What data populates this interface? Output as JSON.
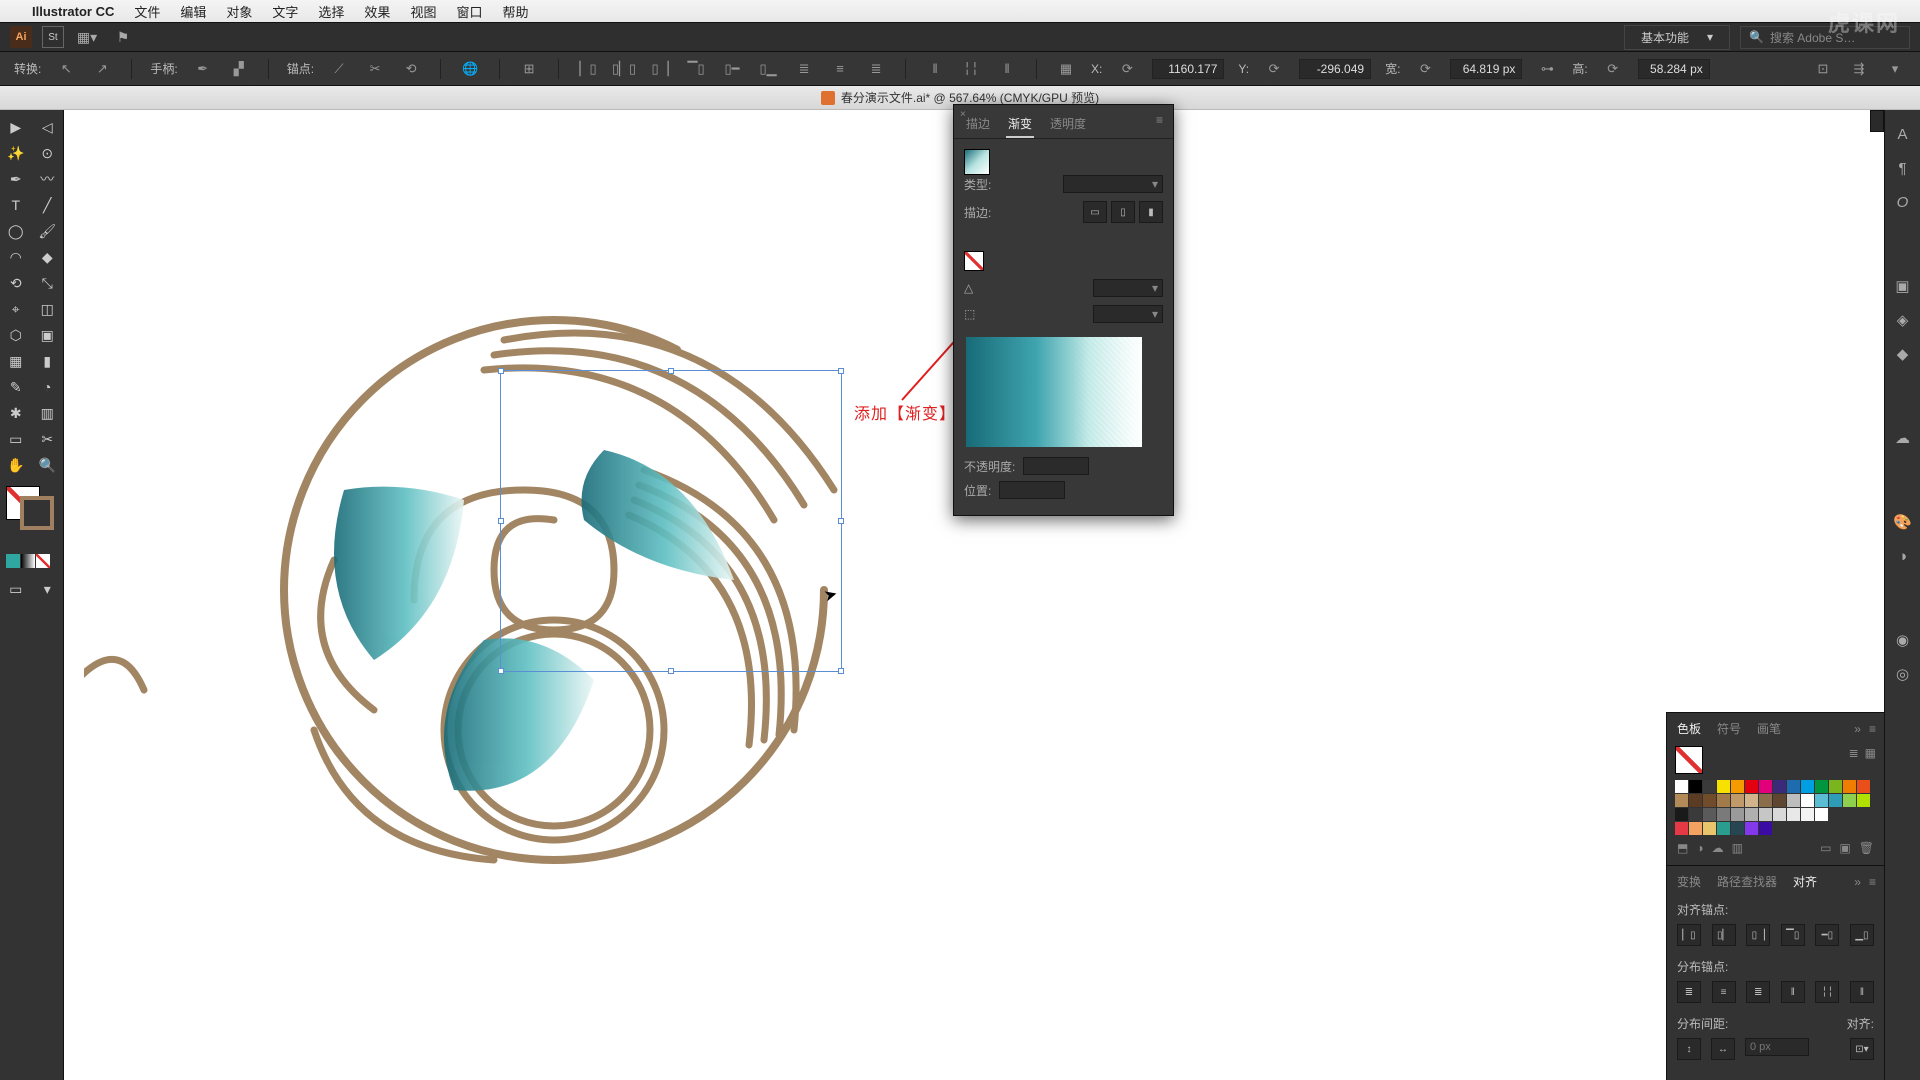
{
  "watermark": "虎课网",
  "mac_menu": {
    "app_name": "Illustrator CC",
    "items": [
      "文件",
      "编辑",
      "对象",
      "文字",
      "选择",
      "效果",
      "视图",
      "窗口",
      "帮助"
    ]
  },
  "app_bar": {
    "ai_label": "Ai",
    "st_label": "St",
    "basic_func": "基本功能",
    "search_placeholder": "搜索 Adobe S…"
  },
  "control_bar": {
    "transform_label": "转换:",
    "handle_label": "手柄:",
    "anchor_label": "锚点:",
    "x_label": "X:",
    "x_value": "1160.177",
    "y_label": "Y:",
    "y_value": "-296.049",
    "w_label": "宽:",
    "w_value": "64.819 px",
    "h_label": "高:",
    "h_value": "58.284 px"
  },
  "document": {
    "title": "春分演示文件.ai* @ 567.64% (CMYK/GPU 预览)"
  },
  "annotation": {
    "text": "添加【渐变】效果"
  },
  "gradient_panel": {
    "tab_stroke": "描边",
    "tab_gradient": "渐变",
    "tab_opacity": "透明度",
    "type_label": "类型:",
    "stroke_label": "描边:",
    "opacity_label": "不透明度:",
    "position_label": "位置:"
  },
  "swatches_panel": {
    "tab_swatches": "色板",
    "tab_symbols": "符号",
    "tab_brushes": "画笔",
    "colors_row1": [
      "#ffffff",
      "#000000",
      "#3a3a3a",
      "#f6e100",
      "#f59b00",
      "#e3000f",
      "#e2007a",
      "#3b2a7a",
      "#1f6bb0",
      "#009fe3",
      "#009640",
      "#7ab51d",
      "#ef7d00",
      "#e94e1b"
    ],
    "colors_row2": [
      "#b38b58",
      "#5c3b23",
      "#714c2a",
      "#a37b4a",
      "#c19a6b",
      "#d2b48c",
      "#8a6d4b",
      "#5e4631",
      "#bdbdbd",
      "#ffffff",
      "#5bbdd4",
      "#2e9cb5",
      "#8fd14f",
      "#b0e000"
    ],
    "colors_row3": [
      "#1a1a1a",
      "#3a3a3a",
      "#5a5a5a",
      "#7a7a7a",
      "#9a9a9a",
      "#b0b0b0",
      "#c6c6c6",
      "#d9d9d9",
      "#e8e8e8",
      "#f3f3f3",
      "#ffffff"
    ],
    "colors_row4": [
      "#e63946",
      "#f4a261",
      "#e9c46a",
      "#2a9d8f",
      "#264653",
      "#8338ec",
      "#3a0ca3"
    ]
  },
  "align_panel": {
    "tab_transform": "变换",
    "tab_pathfinder": "路径查找器",
    "tab_align": "对齐",
    "section_align": "对齐锚点:",
    "section_distribute": "分布锚点:",
    "section_spacing": "分布间距:",
    "align_to_label": "对齐:",
    "spacing_value": "0 px"
  }
}
